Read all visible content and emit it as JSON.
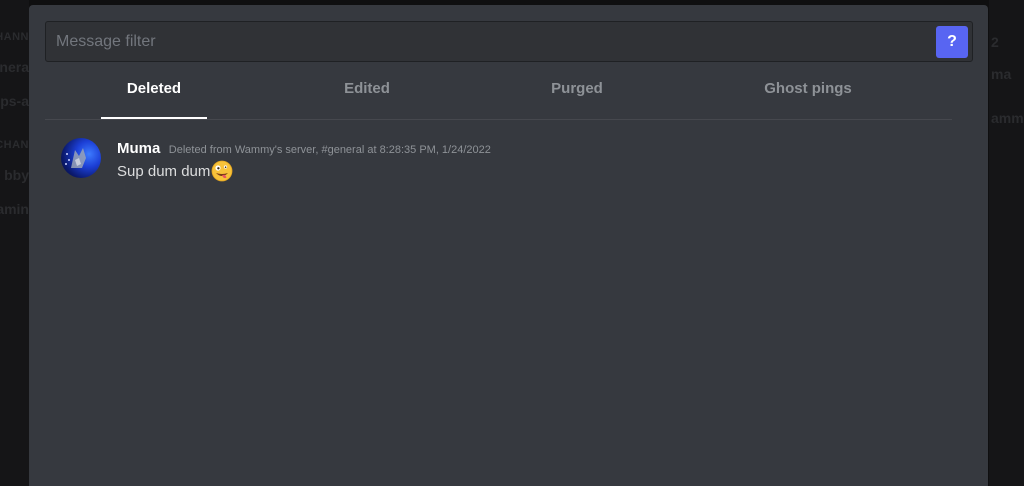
{
  "background": {
    "left_fragments": [
      "CHANN",
      "nera",
      "ps-a",
      "CHAN",
      "bby",
      "amin"
    ],
    "right_fragments": [
      "2",
      "ma",
      "ammy"
    ]
  },
  "filter": {
    "placeholder": "Message filter",
    "value": "",
    "help_label": "?"
  },
  "tabs": [
    {
      "label": "Deleted",
      "active": true
    },
    {
      "label": "Edited",
      "active": false
    },
    {
      "label": "Purged",
      "active": false
    },
    {
      "label": "Ghost pings",
      "active": false
    }
  ],
  "messages": [
    {
      "author": "Muma",
      "meta": "Deleted from Wammy's server, #general at 8:28:35 PM, 1/24/2022",
      "content": "Sup dum dum",
      "emoji": "zany-face-emoji",
      "avatar": "avatar-wolf-blue"
    }
  ],
  "colors": {
    "modal_bg": "#36393f",
    "accent": "#5865f2",
    "tab_active": "#ffffff",
    "tab_inactive": "#8e9297"
  }
}
